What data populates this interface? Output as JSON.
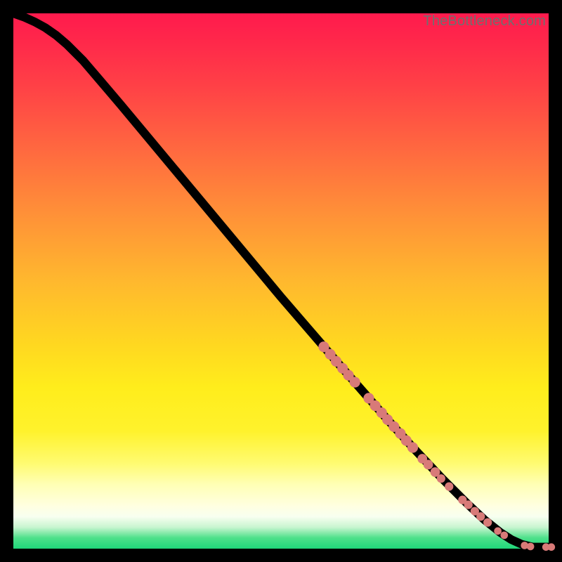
{
  "attribution": "TheBottleneck.com",
  "colors": {
    "marker": "#d87a78",
    "line": "#000000",
    "gradient_top": "#ff1a4d",
    "gradient_bottom": "#1fd67a"
  },
  "chart_data": {
    "type": "line",
    "title": "",
    "xlabel": "",
    "ylabel": "",
    "xlim": [
      0,
      100
    ],
    "ylim": [
      0,
      100
    ],
    "curve": [
      {
        "x": 0,
        "y": 100
      },
      {
        "x": 2,
        "y": 99.3
      },
      {
        "x": 4,
        "y": 98.4
      },
      {
        "x": 6,
        "y": 97.3
      },
      {
        "x": 8,
        "y": 95.9
      },
      {
        "x": 10,
        "y": 94.2
      },
      {
        "x": 13,
        "y": 91.2
      },
      {
        "x": 16,
        "y": 87.7
      },
      {
        "x": 20,
        "y": 83.0
      },
      {
        "x": 25,
        "y": 77.0
      },
      {
        "x": 30,
        "y": 71.0
      },
      {
        "x": 35,
        "y": 65.0
      },
      {
        "x": 40,
        "y": 59.0
      },
      {
        "x": 45,
        "y": 53.0
      },
      {
        "x": 50,
        "y": 47.0
      },
      {
        "x": 55,
        "y": 41.2
      },
      {
        "x": 60,
        "y": 35.4
      },
      {
        "x": 65,
        "y": 29.7
      },
      {
        "x": 70,
        "y": 24.0
      },
      {
        "x": 75,
        "y": 18.5
      },
      {
        "x": 80,
        "y": 13.2
      },
      {
        "x": 85,
        "y": 8.2
      },
      {
        "x": 88,
        "y": 5.4
      },
      {
        "x": 91,
        "y": 3.0
      },
      {
        "x": 93,
        "y": 1.7
      },
      {
        "x": 95,
        "y": 0.8
      },
      {
        "x": 97,
        "y": 0.3
      },
      {
        "x": 100,
        "y": 0.3
      }
    ],
    "markers": [
      {
        "x": 58.0,
        "y": 37.7,
        "r": 1.0
      },
      {
        "x": 59.2,
        "y": 36.3,
        "r": 1.0
      },
      {
        "x": 60.3,
        "y": 35.0,
        "r": 1.0
      },
      {
        "x": 61.5,
        "y": 33.7,
        "r": 1.0
      },
      {
        "x": 62.6,
        "y": 32.4,
        "r": 1.0
      },
      {
        "x": 63.8,
        "y": 31.1,
        "r": 1.0
      },
      {
        "x": 66.4,
        "y": 28.1,
        "r": 1.0
      },
      {
        "x": 67.6,
        "y": 26.7,
        "r": 1.0
      },
      {
        "x": 68.8,
        "y": 25.4,
        "r": 1.0
      },
      {
        "x": 69.9,
        "y": 24.1,
        "r": 1.0
      },
      {
        "x": 71.1,
        "y": 22.8,
        "r": 1.0
      },
      {
        "x": 72.3,
        "y": 21.5,
        "r": 1.0
      },
      {
        "x": 73.4,
        "y": 20.2,
        "r": 1.0
      },
      {
        "x": 74.6,
        "y": 18.9,
        "r": 1.0
      },
      {
        "x": 76.4,
        "y": 16.8,
        "r": 0.9
      },
      {
        "x": 77.5,
        "y": 15.7,
        "r": 0.9
      },
      {
        "x": 78.8,
        "y": 14.3,
        "r": 0.9
      },
      {
        "x": 79.9,
        "y": 13.1,
        "r": 0.8
      },
      {
        "x": 81.4,
        "y": 11.6,
        "r": 0.8
      },
      {
        "x": 83.9,
        "y": 9.1,
        "r": 0.8
      },
      {
        "x": 85.0,
        "y": 8.2,
        "r": 0.8
      },
      {
        "x": 86.2,
        "y": 7.0,
        "r": 0.8
      },
      {
        "x": 87.3,
        "y": 6.0,
        "r": 0.8
      },
      {
        "x": 88.6,
        "y": 4.9,
        "r": 0.8
      },
      {
        "x": 90.5,
        "y": 3.3,
        "r": 0.7
      },
      {
        "x": 91.7,
        "y": 2.5,
        "r": 0.7
      },
      {
        "x": 95.5,
        "y": 0.6,
        "r": 0.7
      },
      {
        "x": 96.6,
        "y": 0.4,
        "r": 0.7
      },
      {
        "x": 99.5,
        "y": 0.3,
        "r": 0.7
      },
      {
        "x": 100.5,
        "y": 0.3,
        "r": 0.7
      }
    ]
  }
}
